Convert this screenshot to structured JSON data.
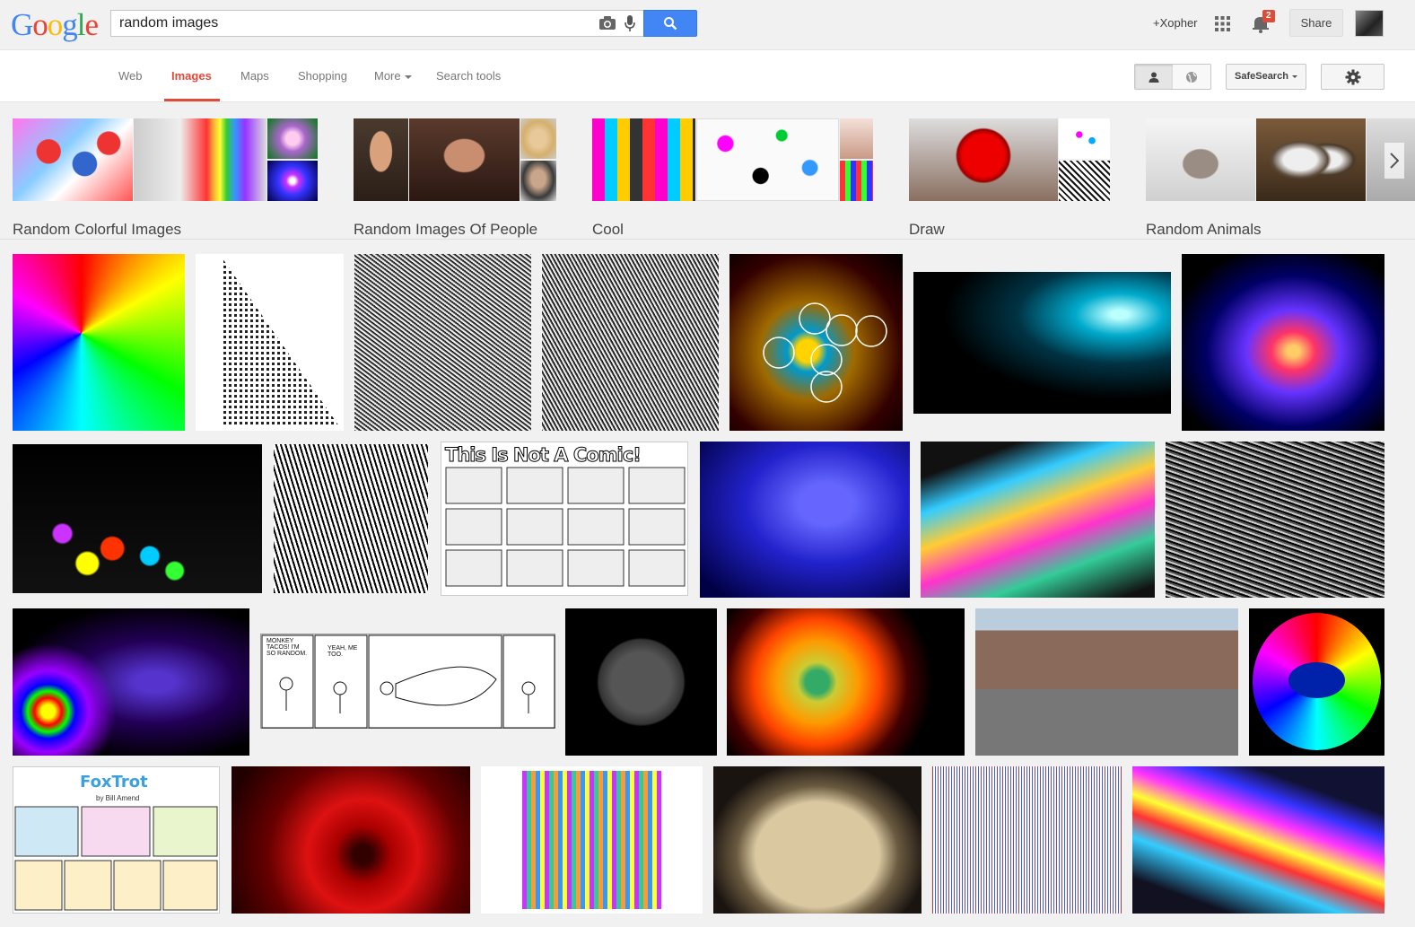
{
  "logo": {
    "letters": [
      {
        "ch": "G",
        "color": "#4285f4"
      },
      {
        "ch": "o",
        "color": "#ea4335"
      },
      {
        "ch": "o",
        "color": "#fbbc05"
      },
      {
        "ch": "g",
        "color": "#4285f4"
      },
      {
        "ch": "l",
        "color": "#34a853"
      },
      {
        "ch": "e",
        "color": "#ea4335"
      }
    ]
  },
  "search": {
    "query": "random images"
  },
  "header": {
    "user_name": "+Xopher",
    "notification_count": "2",
    "share_label": "Share"
  },
  "nav": {
    "tabs": [
      {
        "label": "Web"
      },
      {
        "label": "Images",
        "active": true
      },
      {
        "label": "Maps"
      },
      {
        "label": "Shopping"
      },
      {
        "label": "More"
      },
      {
        "label": "Search tools"
      }
    ],
    "safesearch_label": "SafeSearch"
  },
  "related": [
    {
      "label": "Random Colorful Images"
    },
    {
      "label": "Random Images Of People"
    },
    {
      "label": "Cool"
    },
    {
      "label": "Draw"
    },
    {
      "label": "Random Animals"
    }
  ],
  "results": {
    "row1_titles": [
      "",
      "",
      "",
      "",
      "",
      "",
      ""
    ],
    "comic_title": "This Is Not A Comic!",
    "foxtrot_title": "FoxTrot",
    "foxtrot_byline": "by Bill Amend",
    "xkcd_caption_1": "MONKEY TACOS! I'M SO RANDOM.",
    "xkcd_caption_2": "YEAH, ME TOO."
  },
  "colors": {
    "accent": "#dd4b39",
    "search_blue": "#4285f4",
    "badge_red": "#dd4b39"
  }
}
